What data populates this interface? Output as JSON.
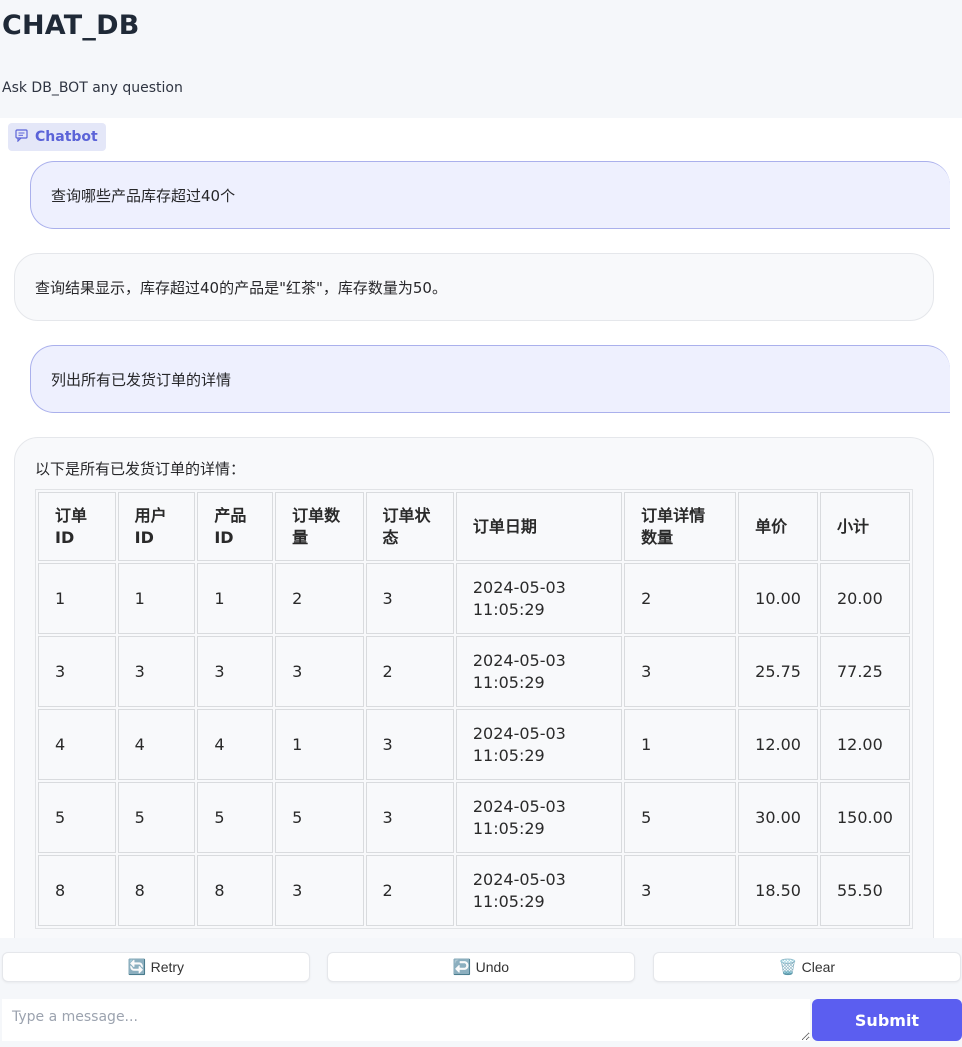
{
  "header": {
    "title": "CHAT_DB",
    "subtitle": "Ask DB_BOT any question"
  },
  "chatbot": {
    "label": "Chatbot",
    "messages": [
      {
        "role": "user",
        "text": "查询哪些产品库存超过40个"
      },
      {
        "role": "bot",
        "text": "查询结果显示，库存超过40的产品是\"红茶\"，库存数量为50。"
      },
      {
        "role": "user",
        "text": "列出所有已发货订单的详情"
      },
      {
        "role": "bot",
        "text": "以下是所有已发货订单的详情："
      }
    ],
    "table": {
      "headers": [
        "订单ID",
        "用户ID",
        "产品ID",
        "订单数量",
        "订单状态",
        "订单日期",
        "订单详情数量",
        "单价",
        "小计"
      ],
      "rows": [
        [
          "1",
          "1",
          "1",
          "2",
          "3",
          "2024-05-03 11:05:29",
          "2",
          "10.00",
          "20.00"
        ],
        [
          "3",
          "3",
          "3",
          "3",
          "2",
          "2024-05-03 11:05:29",
          "3",
          "25.75",
          "77.25"
        ],
        [
          "4",
          "4",
          "4",
          "1",
          "3",
          "2024-05-03 11:05:29",
          "1",
          "12.00",
          "12.00"
        ],
        [
          "5",
          "5",
          "5",
          "5",
          "3",
          "2024-05-03 11:05:29",
          "5",
          "30.00",
          "150.00"
        ],
        [
          "8",
          "8",
          "8",
          "3",
          "2",
          "2024-05-03 11:05:29",
          "3",
          "18.50",
          "55.50"
        ]
      ]
    }
  },
  "actions": {
    "retry": {
      "icon": "retry-icon",
      "label": "Retry"
    },
    "undo": {
      "icon": "undo-icon",
      "label": "Undo"
    },
    "clear": {
      "icon": "trash-icon",
      "label": "Clear"
    }
  },
  "input": {
    "placeholder": "Type a message...",
    "value": ""
  },
  "submit_label": "Submit",
  "colors": {
    "accent": "#5b5ef0",
    "user_bubble": "#eef0fe",
    "bot_bubble": "#f8f9fb",
    "label_bg": "#e4e7f8"
  }
}
